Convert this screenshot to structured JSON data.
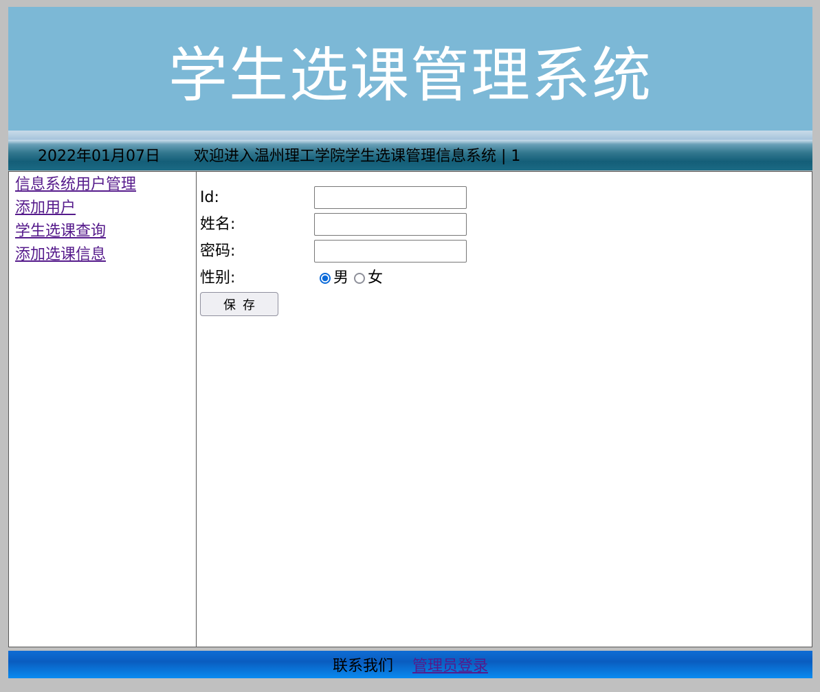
{
  "header": {
    "title": "学生选课管理系统",
    "date": "2022年01月07日",
    "welcome": "欢迎进入温州理工学院学生选课管理信息系统 | 1"
  },
  "sidebar": {
    "items": [
      {
        "label": "信息系统用户管理"
      },
      {
        "label": "添加用户"
      },
      {
        "label": "学生选课查询"
      },
      {
        "label": "添加选课信息"
      }
    ]
  },
  "form": {
    "id_label": "Id:",
    "id_value": "",
    "name_label": "姓名:",
    "name_value": "",
    "password_label": "密码:",
    "password_value": "",
    "gender_label": "性别:",
    "gender_options": [
      {
        "label": "男",
        "checked": true
      },
      {
        "label": "女",
        "checked": false
      }
    ],
    "save_label": "保存"
  },
  "footer": {
    "contact_label": "联系我们",
    "admin_login_label": "管理员登录"
  },
  "colors": {
    "banner": "#7cb8d6",
    "link": "#551a8b",
    "radio_checked": "#0a6ad9",
    "footer": "#0a5dc0"
  }
}
